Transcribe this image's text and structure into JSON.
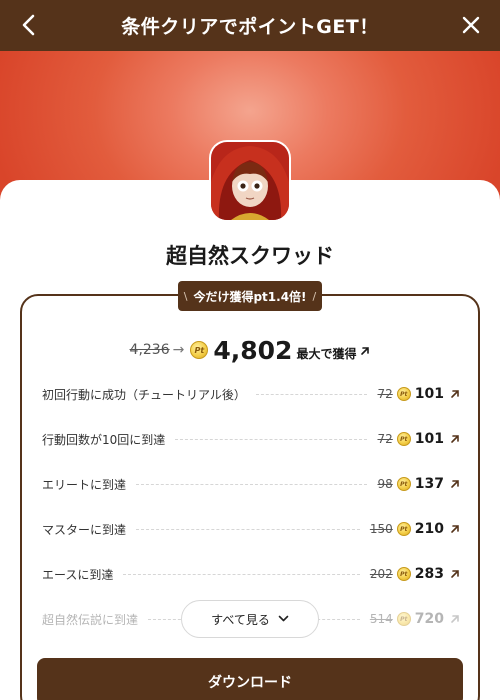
{
  "header": {
    "title": "条件クリアでポイントGET！",
    "back_icon": "chevron-left-icon",
    "close_icon": "close-icon"
  },
  "app": {
    "name": "超自然スクワッド",
    "icon": "app-icon-red-hooded-character"
  },
  "promo": {
    "slash_left": "\\",
    "label": "今だけ獲得pt1.4倍!",
    "slash_right": "/"
  },
  "total": {
    "old_value": "4,236",
    "arrow": "→",
    "coin_label": "Pt",
    "new_value": "4,802",
    "suffix": "最大で獲得"
  },
  "tasks": [
    {
      "label": "初回行動に成功（チュートリアル後）",
      "old": "72",
      "new": "101",
      "faded": false
    },
    {
      "label": "行動回数が10回に到達",
      "old": "72",
      "new": "101",
      "faded": false
    },
    {
      "label": "エリートに到達",
      "old": "98",
      "new": "137",
      "faded": false
    },
    {
      "label": "マスターに到達",
      "old": "150",
      "new": "210",
      "faded": false
    },
    {
      "label": "エースに到達",
      "old": "202",
      "new": "283",
      "faded": false
    },
    {
      "label": "超自然伝説に到達",
      "old": "514",
      "new": "720",
      "faded": true
    }
  ],
  "see_all": {
    "label": "すべて見る"
  },
  "download": {
    "label": "ダウンロード"
  },
  "colors": {
    "brand_brown": "#55331a",
    "hero_red": "#e25c3d",
    "coin_gold": "#f4cf4a"
  }
}
